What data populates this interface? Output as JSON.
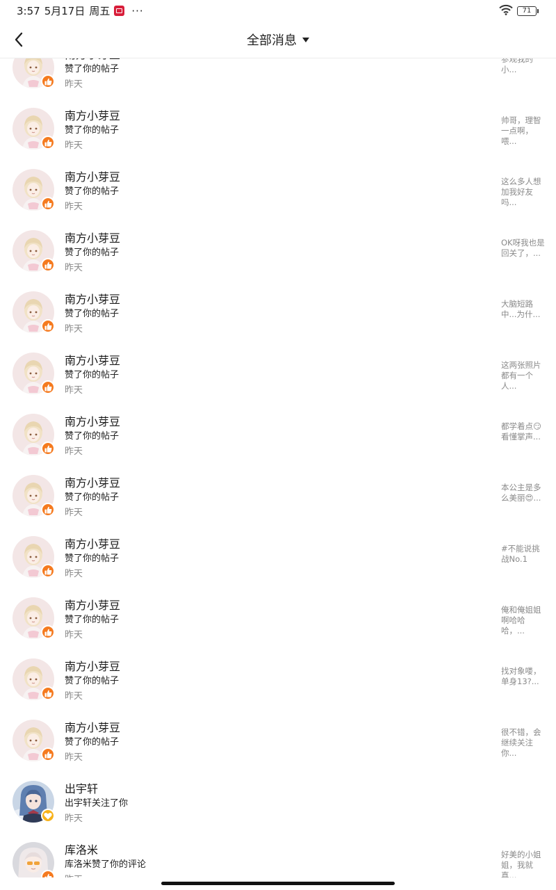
{
  "status_bar": {
    "time": "3:57",
    "date": "5月17日",
    "weekday": "周五",
    "more": "···",
    "battery": "71"
  },
  "header": {
    "title": "全部消息"
  },
  "colors": {
    "like_badge": "#f57a1f",
    "follow_badge": "#f7b21b"
  },
  "messages": [
    {
      "name": "南方小芽豆",
      "action": "赞了你的帖子",
      "time": "昨天",
      "preview": "参观我的小...",
      "avatar": "avatar-girl-pink",
      "badge": "thumbs-up-icon"
    },
    {
      "name": "南方小芽豆",
      "action": "赞了你的帖子",
      "time": "昨天",
      "preview": "帅哥，理智一点啊，喂...",
      "avatar": "avatar-girl-pink",
      "badge": "thumbs-up-icon"
    },
    {
      "name": "南方小芽豆",
      "action": "赞了你的帖子",
      "time": "昨天",
      "preview": "这么多人想加我好友吗...",
      "avatar": "avatar-girl-pink",
      "badge": "thumbs-up-icon"
    },
    {
      "name": "南方小芽豆",
      "action": "赞了你的帖子",
      "time": "昨天",
      "preview": "OK呀我也是回关了，...",
      "avatar": "avatar-girl-pink",
      "badge": "thumbs-up-icon"
    },
    {
      "name": "南方小芽豆",
      "action": "赞了你的帖子",
      "time": "昨天",
      "preview": "大脑短路中...为什...",
      "avatar": "avatar-girl-pink",
      "badge": "thumbs-up-icon"
    },
    {
      "name": "南方小芽豆",
      "action": "赞了你的帖子",
      "time": "昨天",
      "preview": "这两张照片都有一个人...",
      "avatar": "avatar-girl-pink",
      "badge": "thumbs-up-icon"
    },
    {
      "name": "南方小芽豆",
      "action": "赞了你的帖子",
      "time": "昨天",
      "preview": "都学着点😏看懂掌声...",
      "avatar": "avatar-girl-pink",
      "badge": "thumbs-up-icon"
    },
    {
      "name": "南方小芽豆",
      "action": "赞了你的帖子",
      "time": "昨天",
      "preview": "本公主是多么美丽😍...",
      "avatar": "avatar-girl-pink",
      "badge": "thumbs-up-icon"
    },
    {
      "name": "南方小芽豆",
      "action": "赞了你的帖子",
      "time": "昨天",
      "preview": "#不能说挑战No.1",
      "avatar": "avatar-girl-pink",
      "badge": "thumbs-up-icon"
    },
    {
      "name": "南方小芽豆",
      "action": "赞了你的帖子",
      "time": "昨天",
      "preview": "俺和俺姐姐啊哈哈哈，...",
      "avatar": "avatar-girl-pink",
      "badge": "thumbs-up-icon"
    },
    {
      "name": "南方小芽豆",
      "action": "赞了你的帖子",
      "time": "昨天",
      "preview": "找对象喽，单身13?...",
      "avatar": "avatar-girl-pink",
      "badge": "thumbs-up-icon"
    },
    {
      "name": "南方小芽豆",
      "action": "赞了你的帖子",
      "time": "昨天",
      "preview": "很不错，会继续关注你...",
      "avatar": "avatar-girl-pink",
      "badge": "thumbs-up-icon"
    },
    {
      "name": "出宇轩",
      "action": "出宇轩关注了你",
      "time": "昨天",
      "preview": "",
      "avatar": "avatar-girl-blue",
      "badge": "heart-icon"
    },
    {
      "name": "库洛米",
      "action": "库洛米赞了你的评论",
      "time": "昨天",
      "preview": "好美的小姐姐，我就真...",
      "avatar": "avatar-girl-gray",
      "badge": "thumbs-up-icon"
    }
  ]
}
